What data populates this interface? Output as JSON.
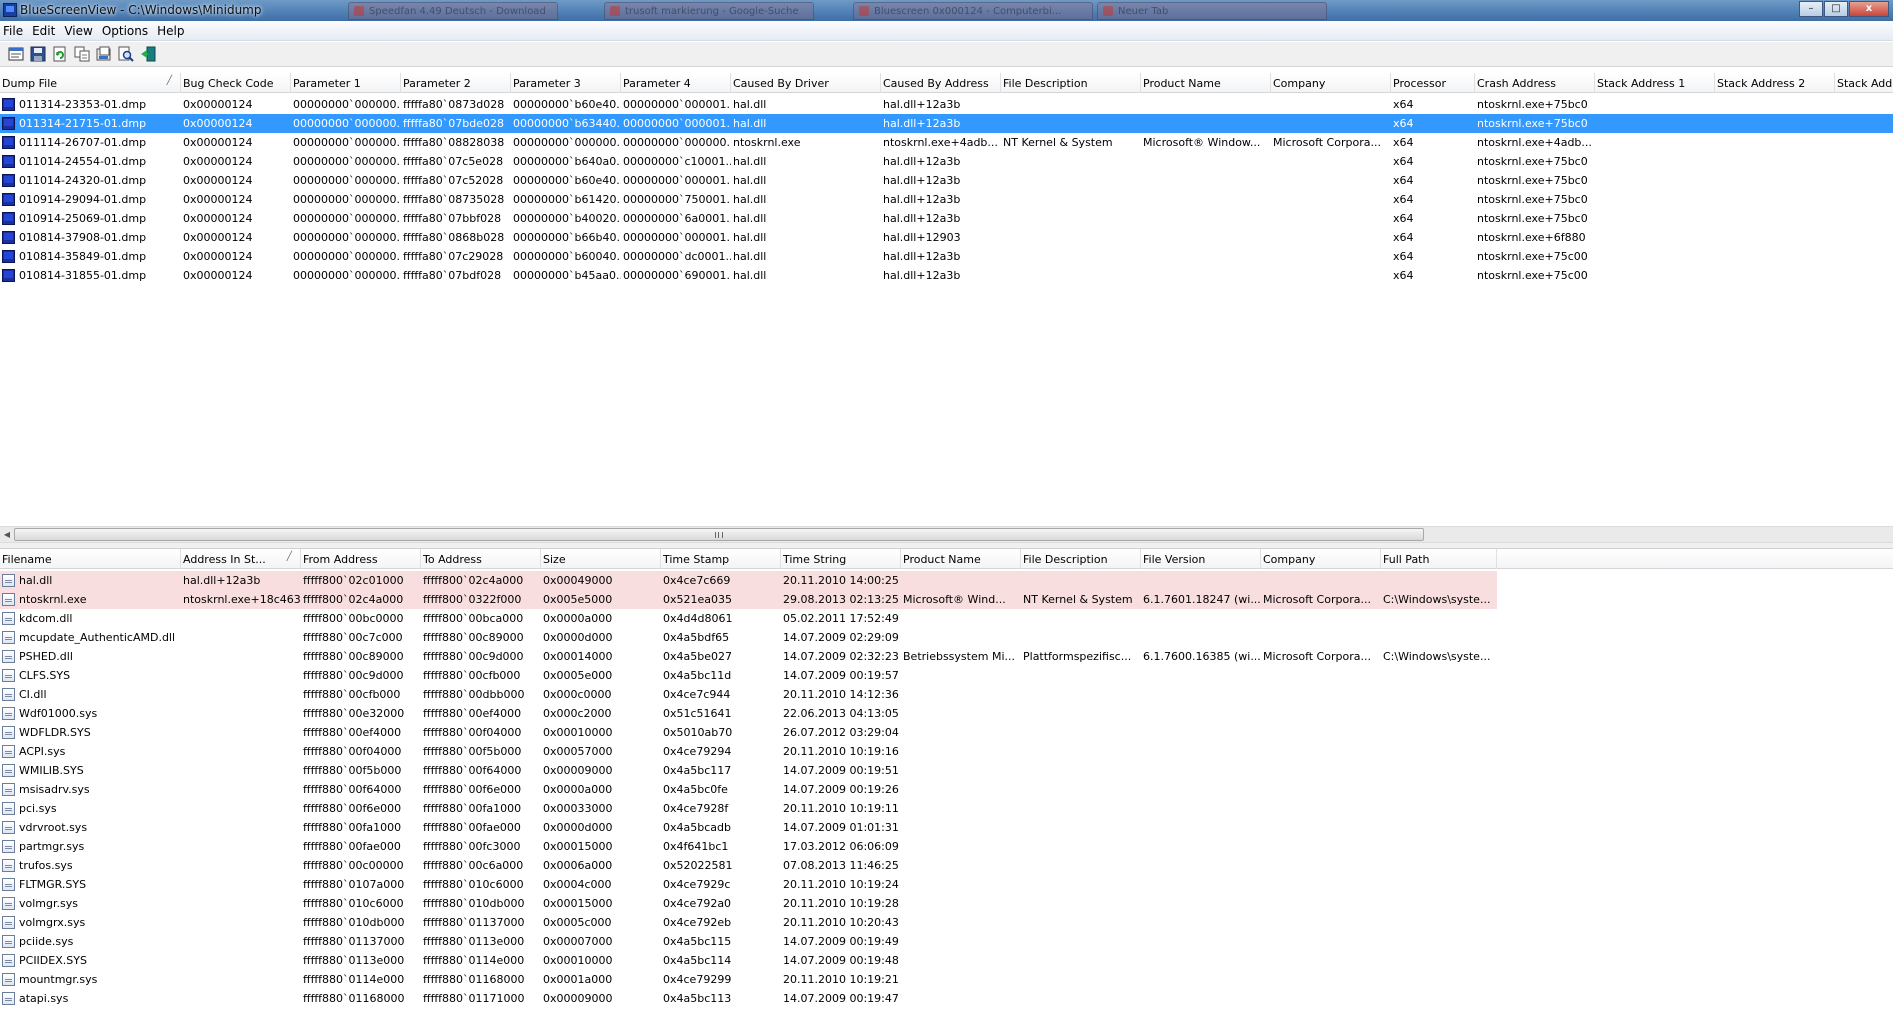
{
  "window": {
    "title": "BlueScreenView  -  C:\\Windows\\Minidump",
    "background_tabs": [
      "Speedfan 4.49 Deutsch - Download",
      "trusoft markierung - Google-Suche",
      "Bluescreen 0x000124 - Computerbi...",
      "Neuer Tab"
    ],
    "minimize": "–",
    "maximize": "□",
    "close": "x"
  },
  "menu": [
    "File",
    "Edit",
    "View",
    "Options",
    "Help"
  ],
  "toolbar": [
    "properties-icon",
    "save-icon",
    "refresh-icon",
    "copy-icon",
    "report-icon",
    "find-icon",
    "exit-icon"
  ],
  "colors": {
    "selection": "#3399ff",
    "highlight": "#f8dede",
    "bsod_icon": "#1a2f9c"
  },
  "dumps": {
    "columns": [
      "Dump File",
      "Bug Check Code",
      "Parameter 1",
      "Parameter 2",
      "Parameter 3",
      "Parameter 4",
      "Caused By Driver",
      "Caused By Address",
      "File Description",
      "Product Name",
      "Company",
      "Processor",
      "Crash Address",
      "Stack Address 1",
      "Stack Address 2",
      "Stack Addre"
    ],
    "sort_indicator": "╱",
    "rows": [
      [
        "011314-23353-01.dmp",
        "0x00000124",
        "00000000`000000...",
        "fffffa80`0873d028",
        "00000000`b60e40...",
        "00000000`000001...",
        "hal.dll",
        "hal.dll+12a3b",
        "",
        "",
        "",
        "x64",
        "ntoskrnl.exe+75bc0",
        "",
        "",
        ""
      ],
      [
        "011314-21715-01.dmp",
        "0x00000124",
        "00000000`000000...",
        "fffffa80`07bde028",
        "00000000`b63440...",
        "00000000`000001...",
        "hal.dll",
        "hal.dll+12a3b",
        "",
        "",
        "",
        "x64",
        "ntoskrnl.exe+75bc0",
        "",
        "",
        ""
      ],
      [
        "011114-26707-01.dmp",
        "0x00000124",
        "00000000`000000...",
        "fffffa80`08828038",
        "00000000`000000...",
        "00000000`000000...",
        "ntoskrnl.exe",
        "ntoskrnl.exe+4adb...",
        "NT Kernel & System",
        "Microsoft® Window...",
        "Microsoft Corpora...",
        "x64",
        "ntoskrnl.exe+4adb...",
        "",
        "",
        ""
      ],
      [
        "011014-24554-01.dmp",
        "0x00000124",
        "00000000`000000...",
        "fffffa80`07c5e028",
        "00000000`b640a0...",
        "00000000`c10001...",
        "hal.dll",
        "hal.dll+12a3b",
        "",
        "",
        "",
        "x64",
        "ntoskrnl.exe+75bc0",
        "",
        "",
        ""
      ],
      [
        "011014-24320-01.dmp",
        "0x00000124",
        "00000000`000000...",
        "fffffa80`07c52028",
        "00000000`b60e40...",
        "00000000`000001...",
        "hal.dll",
        "hal.dll+12a3b",
        "",
        "",
        "",
        "x64",
        "ntoskrnl.exe+75bc0",
        "",
        "",
        ""
      ],
      [
        "010914-29094-01.dmp",
        "0x00000124",
        "00000000`000000...",
        "fffffa80`08735028",
        "00000000`b61420...",
        "00000000`750001...",
        "hal.dll",
        "hal.dll+12a3b",
        "",
        "",
        "",
        "x64",
        "ntoskrnl.exe+75bc0",
        "",
        "",
        ""
      ],
      [
        "010914-25069-01.dmp",
        "0x00000124",
        "00000000`000000...",
        "fffffa80`07bbf028",
        "00000000`b40020...",
        "00000000`6a0001...",
        "hal.dll",
        "hal.dll+12a3b",
        "",
        "",
        "",
        "x64",
        "ntoskrnl.exe+75bc0",
        "",
        "",
        ""
      ],
      [
        "010814-37908-01.dmp",
        "0x00000124",
        "00000000`000000...",
        "fffffa80`0868b028",
        "00000000`b66b40...",
        "00000000`000001...",
        "hal.dll",
        "hal.dll+12903",
        "",
        "",
        "",
        "x64",
        "ntoskrnl.exe+6f880",
        "",
        "",
        ""
      ],
      [
        "010814-35849-01.dmp",
        "0x00000124",
        "00000000`000000...",
        "fffffa80`07c29028",
        "00000000`b60040...",
        "00000000`dc0001...",
        "hal.dll",
        "hal.dll+12a3b",
        "",
        "",
        "",
        "x64",
        "ntoskrnl.exe+75c00",
        "",
        "",
        ""
      ],
      [
        "010814-31855-01.dmp",
        "0x00000124",
        "00000000`000000...",
        "fffffa80`07bdf028",
        "00000000`b45aa0...",
        "00000000`690001...",
        "hal.dll",
        "hal.dll+12a3b",
        "",
        "",
        "",
        "x64",
        "ntoskrnl.exe+75c00",
        "",
        "",
        ""
      ]
    ],
    "selected_row": 1
  },
  "drivers": {
    "columns": [
      "Filename",
      "Address In St...",
      "From Address",
      "To Address",
      "Size",
      "Time Stamp",
      "Time String",
      "Product Name",
      "File Description",
      "File Version",
      "Company",
      "Full Path"
    ],
    "sort_indicator": "╱",
    "rows": [
      [
        "hal.dll",
        "hal.dll+12a3b",
        "fffff800`02c01000",
        "fffff800`02c4a000",
        "0x00049000",
        "0x4ce7c669",
        "20.11.2010 14:00:25",
        "",
        "",
        "",
        "",
        ""
      ],
      [
        "ntoskrnl.exe",
        "ntoskrnl.exe+18c463",
        "fffff800`02c4a000",
        "fffff800`0322f000",
        "0x005e5000",
        "0x521ea035",
        "29.08.2013 02:13:25",
        "Microsoft® Wind...",
        "NT Kernel & System",
        "6.1.7601.18247 (wi...",
        "Microsoft Corpora...",
        "C:\\Windows\\syste..."
      ],
      [
        "kdcom.dll",
        "",
        "fffff800`00bc0000",
        "fffff800`00bca000",
        "0x0000a000",
        "0x4d4d8061",
        "05.02.2011 17:52:49",
        "",
        "",
        "",
        "",
        ""
      ],
      [
        "mcupdate_AuthenticAMD.dll",
        "",
        "fffff880`00c7c000",
        "fffff880`00c89000",
        "0x0000d000",
        "0x4a5bdf65",
        "14.07.2009 02:29:09",
        "",
        "",
        "",
        "",
        ""
      ],
      [
        "PSHED.dll",
        "",
        "fffff880`00c89000",
        "fffff880`00c9d000",
        "0x00014000",
        "0x4a5be027",
        "14.07.2009 02:32:23",
        "Betriebssystem Mi...",
        "Plattformspezifisc...",
        "6.1.7600.16385 (wi...",
        "Microsoft Corpora...",
        "C:\\Windows\\syste..."
      ],
      [
        "CLFS.SYS",
        "",
        "fffff880`00c9d000",
        "fffff880`00cfb000",
        "0x0005e000",
        "0x4a5bc11d",
        "14.07.2009 00:19:57",
        "",
        "",
        "",
        "",
        ""
      ],
      [
        "CI.dll",
        "",
        "fffff880`00cfb000",
        "fffff880`00dbb000",
        "0x000c0000",
        "0x4ce7c944",
        "20.11.2010 14:12:36",
        "",
        "",
        "",
        "",
        ""
      ],
      [
        "Wdf01000.sys",
        "",
        "fffff880`00e32000",
        "fffff880`00ef4000",
        "0x000c2000",
        "0x51c51641",
        "22.06.2013 04:13:05",
        "",
        "",
        "",
        "",
        ""
      ],
      [
        "WDFLDR.SYS",
        "",
        "fffff880`00ef4000",
        "fffff880`00f04000",
        "0x00010000",
        "0x5010ab70",
        "26.07.2012 03:29:04",
        "",
        "",
        "",
        "",
        ""
      ],
      [
        "ACPI.sys",
        "",
        "fffff880`00f04000",
        "fffff880`00f5b000",
        "0x00057000",
        "0x4ce79294",
        "20.11.2010 10:19:16",
        "",
        "",
        "",
        "",
        ""
      ],
      [
        "WMILIB.SYS",
        "",
        "fffff880`00f5b000",
        "fffff880`00f64000",
        "0x00009000",
        "0x4a5bc117",
        "14.07.2009 00:19:51",
        "",
        "",
        "",
        "",
        ""
      ],
      [
        "msisadrv.sys",
        "",
        "fffff880`00f64000",
        "fffff880`00f6e000",
        "0x0000a000",
        "0x4a5bc0fe",
        "14.07.2009 00:19:26",
        "",
        "",
        "",
        "",
        ""
      ],
      [
        "pci.sys",
        "",
        "fffff880`00f6e000",
        "fffff880`00fa1000",
        "0x00033000",
        "0x4ce7928f",
        "20.11.2010 10:19:11",
        "",
        "",
        "",
        "",
        ""
      ],
      [
        "vdrvroot.sys",
        "",
        "fffff880`00fa1000",
        "fffff880`00fae000",
        "0x0000d000",
        "0x4a5bcadb",
        "14.07.2009 01:01:31",
        "",
        "",
        "",
        "",
        ""
      ],
      [
        "partmgr.sys",
        "",
        "fffff880`00fae000",
        "fffff880`00fc3000",
        "0x00015000",
        "0x4f641bc1",
        "17.03.2012 06:06:09",
        "",
        "",
        "",
        "",
        ""
      ],
      [
        "trufos.sys",
        "",
        "fffff880`00c00000",
        "fffff880`00c6a000",
        "0x0006a000",
        "0x52022581",
        "07.08.2013 11:46:25",
        "",
        "",
        "",
        "",
        ""
      ],
      [
        "FLTMGR.SYS",
        "",
        "fffff880`0107a000",
        "fffff880`010c6000",
        "0x0004c000",
        "0x4ce7929c",
        "20.11.2010 10:19:24",
        "",
        "",
        "",
        "",
        ""
      ],
      [
        "volmgr.sys",
        "",
        "fffff880`010c6000",
        "fffff880`010db000",
        "0x00015000",
        "0x4ce792a0",
        "20.11.2010 10:19:28",
        "",
        "",
        "",
        "",
        ""
      ],
      [
        "volmgrx.sys",
        "",
        "fffff880`010db000",
        "fffff880`01137000",
        "0x0005c000",
        "0x4ce792eb",
        "20.11.2010 10:20:43",
        "",
        "",
        "",
        "",
        ""
      ],
      [
        "pciide.sys",
        "",
        "fffff880`01137000",
        "fffff880`0113e000",
        "0x00007000",
        "0x4a5bc115",
        "14.07.2009 00:19:49",
        "",
        "",
        "",
        "",
        ""
      ],
      [
        "PCIIDEX.SYS",
        "",
        "fffff880`0113e000",
        "fffff880`0114e000",
        "0x00010000",
        "0x4a5bc114",
        "14.07.2009 00:19:48",
        "",
        "",
        "",
        "",
        ""
      ],
      [
        "mountmgr.sys",
        "",
        "fffff880`0114e000",
        "fffff880`01168000",
        "0x0001a000",
        "0x4ce79299",
        "20.11.2010 10:19:21",
        "",
        "",
        "",
        "",
        ""
      ],
      [
        "atapi.sys",
        "",
        "fffff880`01168000",
        "fffff880`01171000",
        "0x00009000",
        "0x4a5bc113",
        "14.07.2009 00:19:47",
        "",
        "",
        "",
        "",
        ""
      ]
    ],
    "highlighted_rows": [
      0,
      1
    ]
  }
}
